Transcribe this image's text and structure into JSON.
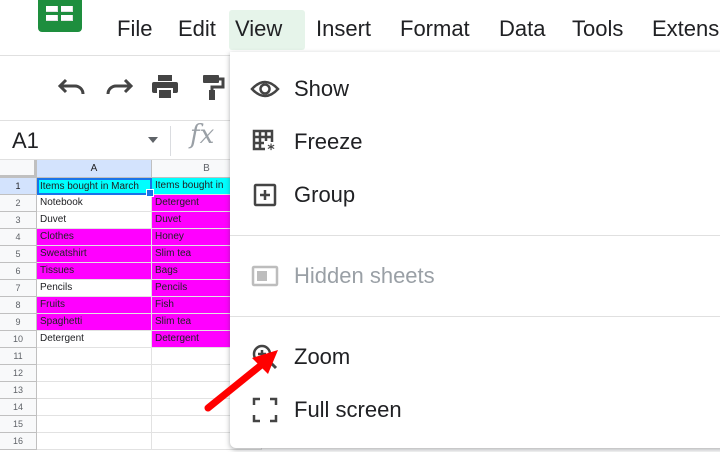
{
  "menu": {
    "items": [
      "File",
      "Edit",
      "View",
      "Insert",
      "Format",
      "Data",
      "Tools",
      "Extens"
    ],
    "active": "View"
  },
  "toolbar": {
    "icons": [
      "undo-icon",
      "redo-icon",
      "print-icon",
      "paint-format-icon"
    ]
  },
  "formula_bar": {
    "name_box": "A1",
    "fx": "fx"
  },
  "grid": {
    "columns": [
      "A",
      "B"
    ],
    "rows": [
      "1",
      "2",
      "3",
      "4",
      "5",
      "6",
      "7",
      "8",
      "9",
      "10",
      "11",
      "12",
      "13",
      "14",
      "15",
      "16"
    ],
    "cells": [
      {
        "a": "Items bought in March",
        "b": "Items bought in",
        "a_color": "#00ffff",
        "b_color": "#00ffff"
      },
      {
        "a": "Notebook",
        "b": "Detergent",
        "a_color": "",
        "b_color": "#ff00ff"
      },
      {
        "a": "Duvet",
        "b": "Duvet",
        "a_color": "",
        "b_color": "#ff00ff"
      },
      {
        "a": "Clothes",
        "b": "Honey",
        "a_color": "#ff00ff",
        "b_color": "#ff00ff"
      },
      {
        "a": "Sweatshirt",
        "b": "Slim tea",
        "a_color": "#ff00ff",
        "b_color": "#ff00ff"
      },
      {
        "a": "Tissues",
        "b": "Bags",
        "a_color": "#ff00ff",
        "b_color": "#ff00ff"
      },
      {
        "a": "Pencils",
        "b": "Pencils",
        "a_color": "",
        "b_color": "#ff00ff"
      },
      {
        "a": "Fruits",
        "b": "Fish",
        "a_color": "#ff00ff",
        "b_color": "#ff00ff"
      },
      {
        "a": "Spaghetti",
        "b": "Slim tea",
        "a_color": "#ff00ff",
        "b_color": "#ff00ff"
      },
      {
        "a": "Detergent",
        "b": "Detergent",
        "a_color": "",
        "b_color": "#ff00ff"
      }
    ]
  },
  "view_menu": {
    "items": [
      {
        "label": "Show",
        "icon": "eye-icon",
        "disabled": false
      },
      {
        "label": "Freeze",
        "icon": "freeze-icon",
        "disabled": false
      },
      {
        "label": "Group",
        "icon": "group-icon",
        "disabled": false
      },
      {
        "label": "Hidden sheets",
        "icon": "hidden-sheets-icon",
        "disabled": true
      },
      {
        "label": "Zoom",
        "icon": "zoom-icon",
        "disabled": false
      },
      {
        "label": "Full screen",
        "icon": "fullscreen-icon",
        "disabled": false
      }
    ]
  },
  "annotation": {
    "arrow_color": "#ff0000",
    "points_to": "Zoom"
  },
  "colors": {
    "brand": "#1e8e3e",
    "active_menu_bg": "#e6f4ea",
    "selection_blue": "#1a73e8"
  }
}
